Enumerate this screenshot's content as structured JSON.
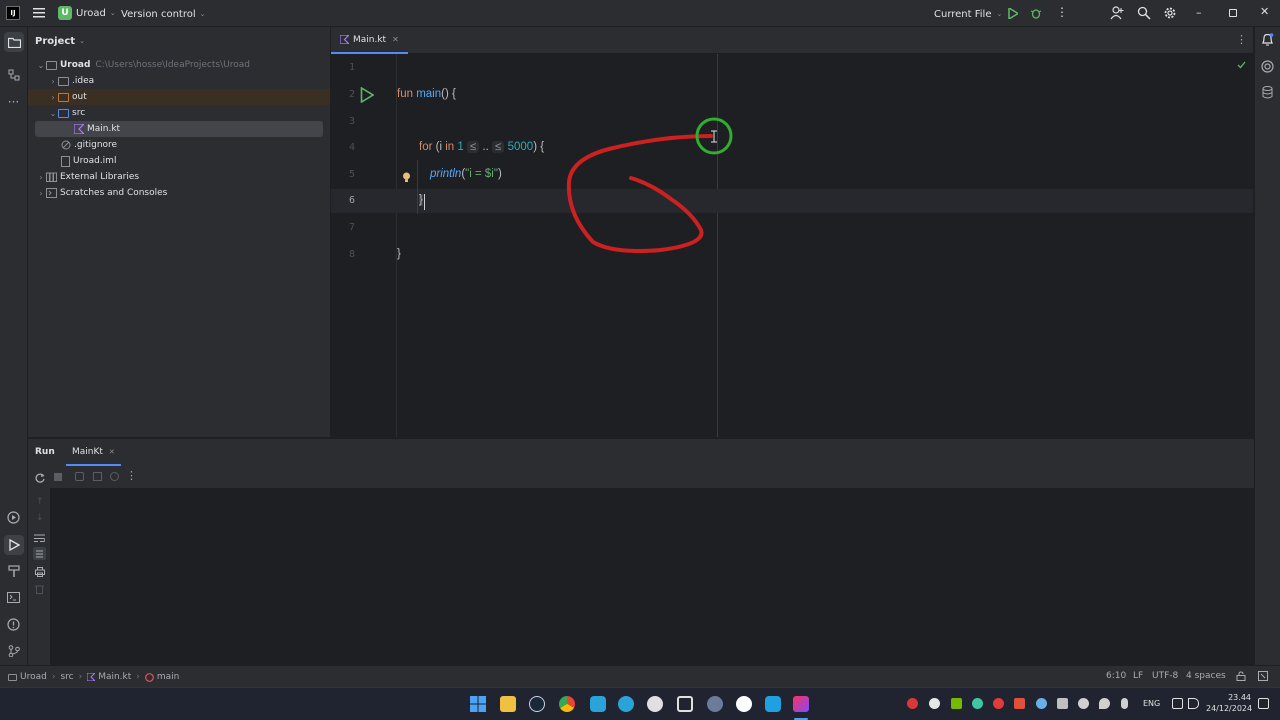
{
  "titlebar": {
    "project_badge": "U",
    "project_name": "Uroad",
    "vcs": "Version control",
    "run_config": "Current File"
  },
  "project_panel": {
    "title": "Project",
    "tree": [
      {
        "label": "Uroad",
        "path": "C:\\Users\\hosse\\IdeaProjects\\Uroad",
        "icon": "folder-icon"
      },
      {
        "label": ".idea",
        "icon": "folder-icon"
      },
      {
        "label": "out",
        "icon": "folder-orange-icon"
      },
      {
        "label": "src",
        "icon": "folder-blue-icon"
      },
      {
        "label": "Main.kt",
        "icon": "kotlin-file-icon"
      },
      {
        "label": ".gitignore",
        "icon": "gitignore-icon"
      },
      {
        "label": "Uroad.iml",
        "icon": "iml-file-icon"
      },
      {
        "label": "External Libraries",
        "icon": "library-icon"
      },
      {
        "label": "Scratches and Consoles",
        "icon": "scratch-icon"
      }
    ]
  },
  "editor": {
    "tab": "Main.kt",
    "line_numbers": [
      "1",
      "2",
      "3",
      "4",
      "5",
      "6",
      "7",
      "8"
    ],
    "code": {
      "l2_kw": "fun",
      "l2_fn": "main",
      "l2_rest": "() {",
      "l4_kw": "for",
      "l4_a": " (i ",
      "l4_in": "in",
      "l4_num1": "1",
      "l4_hint1": "≤",
      "l4_dots": "..",
      "l4_hint2": "≤",
      "l4_num2": "5000",
      "l4_end": ") {",
      "l5_fn": "println",
      "l5_open": "(",
      "l5_str": "\"i = $i\"",
      "l5_close": ")",
      "l6": "}",
      "l8": "}"
    }
  },
  "run_panel": {
    "tab_run": "Run",
    "tab_config": "MainKt"
  },
  "statusbar": {
    "breadcrumb": [
      "Uroad",
      "src",
      "Main.kt",
      "main"
    ],
    "position": "6:10",
    "line_sep": "LF",
    "encoding": "UTF-8",
    "indent": "4 spaces"
  },
  "taskbar": {
    "lang": "ENG",
    "time": "23.44",
    "date": "24/12/2024"
  },
  "colors": {
    "accent_green": "#5fb865",
    "annotation_red": "#e02020",
    "keyword": "#cf8e6d",
    "function": "#56a8f5",
    "number": "#2aacb8",
    "string": "#6aab73"
  }
}
